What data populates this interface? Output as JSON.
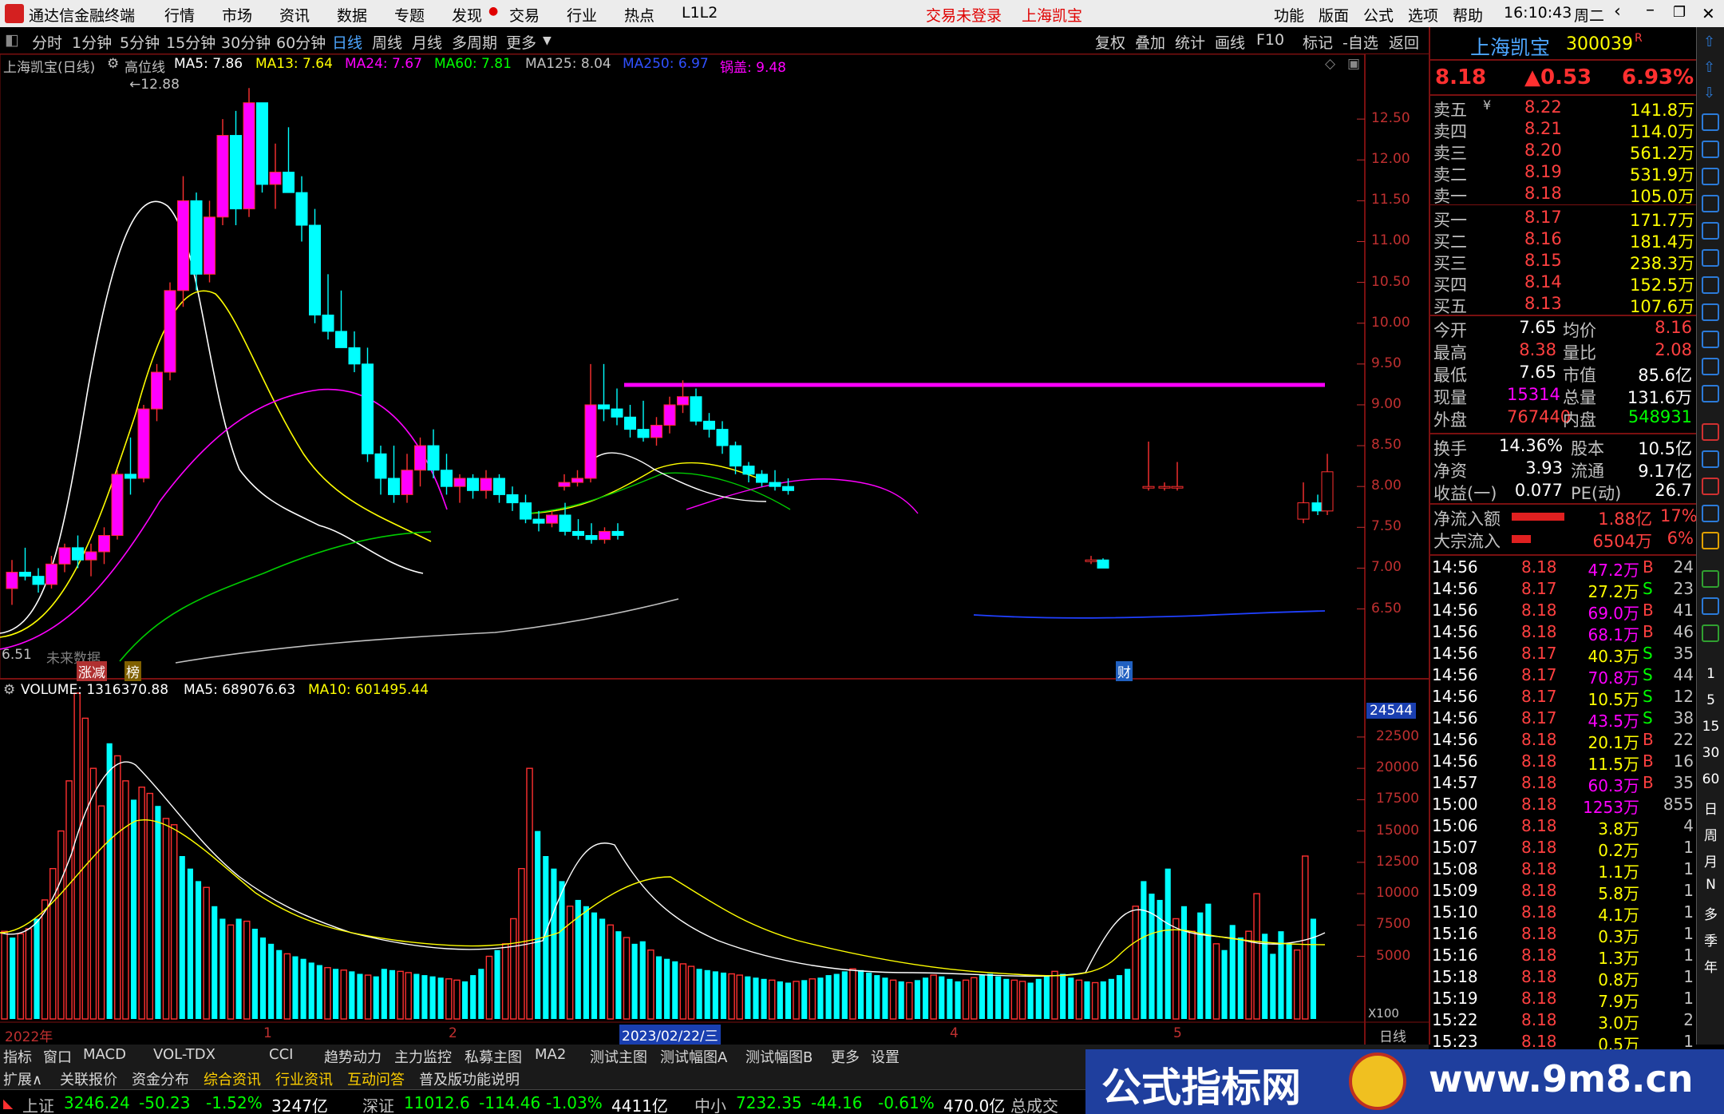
{
  "titlebar": {
    "app_name": "通达信金融终端",
    "menu": [
      "行情",
      "市场",
      "资讯",
      "数据",
      "专题",
      "发现",
      "交易",
      "行业",
      "热点",
      "L1L2"
    ],
    "login_status": "交易未登录",
    "stock_name": "上海凯宝",
    "right_menu": [
      "功能",
      "版面",
      "公式",
      "选项",
      "帮助"
    ],
    "time": "16:10:43",
    "weekday": "周二"
  },
  "periodbar": {
    "periods": [
      "分时",
      "1分钟",
      "5分钟",
      "15分钟",
      "30分钟",
      "60分钟",
      "日线",
      "周线",
      "月线",
      "多周期",
      "更多"
    ],
    "active": "日线",
    "actions": [
      "复权",
      "叠加",
      "统计",
      "画线",
      "F10",
      "标记",
      "-自选",
      "返回"
    ]
  },
  "chart": {
    "header_name": "上海凯宝(日线)",
    "header_indicator": "高位线",
    "ma": [
      {
        "label": "MA5: 7.86",
        "color": "#ffffff"
      },
      {
        "label": "MA13: 7.64",
        "color": "#ffff00"
      },
      {
        "label": "MA24: 7.67",
        "color": "#ff00ff"
      },
      {
        "label": "MA60: 7.81",
        "color": "#00ff00"
      },
      {
        "label": "MA125: 8.04",
        "color": "#c0c0c0"
      },
      {
        "label": "MA250: 6.97",
        "color": "#0000ff"
      },
      {
        "label": "锅盖: 9.48",
        "color": "#ff00ff"
      }
    ],
    "high_mark": "12.88",
    "low_mark": "6.51",
    "note": "未来数据",
    "price_ticks": [
      "12.50",
      "12.00",
      "11.50",
      "11.00",
      "10.50",
      "10.00",
      "9.50",
      "9.00",
      "8.50",
      "8.00",
      "7.50",
      "7.00",
      "6.50"
    ],
    "markers": [
      "涨减",
      "榜",
      "财"
    ],
    "volume_header": "VOLUME: 1316370.88",
    "vol_ma5": "MA5: 689076.63",
    "vol_ma10": "MA10: 601495.44",
    "vol_highlight": "24544",
    "vol_ticks": [
      "22500",
      "20000",
      "17500",
      "15000",
      "12500",
      "10000",
      "7500",
      "5000"
    ],
    "vol_unit": "X100",
    "date_labels": [
      "2022年",
      "1",
      "2",
      "2023/02/22/三",
      "4",
      "5"
    ],
    "period_label": "日线"
  },
  "chart_data": {
    "type": "candlestick",
    "title": "上海凯宝(日线)",
    "ylim": [
      6.3,
      13.0
    ],
    "lid_level": 9.48,
    "candles": [
      [
        6.75,
        7.1,
        6.55,
        6.95
      ],
      [
        6.95,
        7.25,
        6.85,
        6.9
      ],
      [
        6.9,
        7.0,
        6.7,
        6.8
      ],
      [
        6.8,
        7.15,
        6.75,
        7.05
      ],
      [
        7.05,
        7.3,
        6.95,
        7.25
      ],
      [
        7.25,
        7.4,
        7.0,
        7.1
      ],
      [
        7.1,
        7.3,
        6.9,
        7.2
      ],
      [
        7.2,
        7.5,
        7.05,
        7.4
      ],
      [
        7.4,
        8.2,
        7.35,
        8.15
      ],
      [
        8.15,
        8.6,
        7.9,
        8.1
      ],
      [
        8.1,
        9.0,
        8.05,
        8.95
      ],
      [
        8.95,
        9.5,
        8.8,
        9.4
      ],
      [
        9.4,
        10.5,
        9.3,
        10.4
      ],
      [
        10.4,
        11.8,
        10.2,
        11.5
      ],
      [
        11.5,
        11.6,
        10.4,
        10.6
      ],
      [
        10.6,
        11.5,
        10.5,
        11.3
      ],
      [
        11.3,
        12.5,
        11.2,
        12.3
      ],
      [
        12.3,
        12.6,
        11.2,
        11.4
      ],
      [
        11.4,
        12.88,
        11.3,
        12.7
      ],
      [
        12.7,
        12.6,
        11.6,
        11.7
      ],
      [
        11.7,
        12.2,
        11.4,
        11.85
      ],
      [
        11.85,
        12.4,
        11.6,
        11.6
      ],
      [
        11.6,
        11.8,
        11.0,
        11.2
      ],
      [
        11.2,
        11.4,
        10.0,
        10.1
      ],
      [
        10.1,
        10.6,
        9.8,
        9.9
      ],
      [
        9.9,
        10.4,
        9.8,
        9.7
      ],
      [
        9.7,
        9.9,
        9.4,
        9.5
      ],
      [
        9.5,
        9.7,
        8.3,
        8.4
      ],
      [
        8.4,
        8.5,
        7.9,
        8.1
      ],
      [
        8.1,
        8.5,
        7.8,
        7.9
      ],
      [
        7.9,
        8.4,
        7.8,
        8.2
      ],
      [
        8.2,
        8.6,
        8.0,
        8.5
      ],
      [
        8.5,
        8.7,
        8.1,
        8.2
      ],
      [
        8.2,
        8.4,
        7.9,
        8.0
      ],
      [
        8.0,
        8.15,
        7.8,
        8.1
      ],
      [
        8.1,
        8.15,
        7.85,
        7.95
      ],
      [
        7.95,
        8.2,
        7.85,
        8.1
      ],
      [
        8.1,
        8.15,
        7.8,
        7.9
      ],
      [
        7.9,
        8.0,
        7.7,
        7.8
      ],
      [
        7.8,
        7.9,
        7.55,
        7.6
      ],
      [
        7.6,
        7.7,
        7.45,
        7.55
      ],
      [
        7.55,
        7.7,
        7.5,
        7.65
      ],
      [
        7.65,
        7.8,
        7.4,
        7.45
      ],
      [
        7.45,
        7.6,
        7.35,
        7.4
      ],
      [
        7.4,
        7.55,
        7.3,
        7.35
      ],
      [
        7.35,
        7.5,
        7.3,
        7.45
      ],
      [
        7.45,
        7.55,
        7.35,
        7.4
      ]
    ],
    "volume_ticks": [
      5000,
      7500,
      10000,
      12500,
      15000,
      17500,
      20000,
      22500
    ],
    "volume_range": [
      0,
      26000
    ]
  },
  "quote": {
    "name": "上海凯宝",
    "code": "300039",
    "badge": "R",
    "price": "8.18",
    "change": "▲0.53",
    "pct": "6.93%",
    "asks": [
      {
        "label": "卖五",
        "mark": "¥",
        "price": "8.22",
        "vol": "141.8万"
      },
      {
        "label": "卖四",
        "mark": "",
        "price": "8.21",
        "vol": "114.0万"
      },
      {
        "label": "卖三",
        "mark": "",
        "price": "8.20",
        "vol": "561.2万"
      },
      {
        "label": "卖二",
        "mark": "",
        "price": "8.19",
        "vol": "531.9万"
      },
      {
        "label": "卖一",
        "mark": "",
        "price": "8.18",
        "vol": "105.0万"
      }
    ],
    "bids": [
      {
        "label": "买一",
        "price": "8.17",
        "vol": "171.7万"
      },
      {
        "label": "买二",
        "price": "8.16",
        "vol": "181.4万"
      },
      {
        "label": "买三",
        "price": "8.15",
        "vol": "238.3万"
      },
      {
        "label": "买四",
        "price": "8.14",
        "vol": "152.5万"
      },
      {
        "label": "买五",
        "price": "8.13",
        "vol": "107.6万"
      }
    ],
    "stats": [
      {
        "k1": "今开",
        "v1": "7.65",
        "c1": "#ffffff",
        "k2": "均价",
        "v2": "8.16",
        "c2": "#ff4040"
      },
      {
        "k1": "最高",
        "v1": "8.38",
        "c1": "#ff4040",
        "k2": "量比",
        "v2": "2.08",
        "c2": "#ff4040"
      },
      {
        "k1": "最低",
        "v1": "7.65",
        "c1": "#ffffff",
        "k2": "市值",
        "v2": "85.6亿",
        "c2": "#ffffff"
      },
      {
        "k1": "现量",
        "v1": "15314",
        "c1": "#ff00ff",
        "k2": "总量",
        "v2": "131.6万",
        "c2": "#ffffff"
      },
      {
        "k1": "外盘",
        "v1": "767440",
        "c1": "#ff4040",
        "k2": "内盘",
        "v2": "548931",
        "c2": "#00ff00"
      }
    ],
    "fund": [
      {
        "k1": "换手",
        "v1": "14.36%",
        "k2": "股本",
        "v2": "10.5亿"
      },
      {
        "k1": "净资",
        "v1": "3.93",
        "k2": "流通",
        "v2": "9.17亿"
      },
      {
        "k1": "收益(一)",
        "v1": "0.077",
        "k2": "PE(动)",
        "v2": "26.7"
      }
    ],
    "flows": [
      {
        "k": "净流入额",
        "v": "1.88亿",
        "p": "17%",
        "bar": 0.55
      },
      {
        "k": "大宗流入",
        "v": "6504万",
        "p": "6%",
        "bar": 0.2
      }
    ],
    "ticks": [
      {
        "t": "14:56",
        "p": "8.18",
        "v": "47.2万",
        "d": "B",
        "n": "24",
        "pc": "#ff4040",
        "vc": "#ff00ff",
        "dc": "#ff4040"
      },
      {
        "t": "14:56",
        "p": "8.17",
        "v": "27.2万",
        "d": "S",
        "n": "23",
        "pc": "#ff4040",
        "vc": "#ffff00",
        "dc": "#00ff00"
      },
      {
        "t": "14:56",
        "p": "8.18",
        "v": "69.0万",
        "d": "B",
        "n": "41",
        "pc": "#ff4040",
        "vc": "#ff00ff",
        "dc": "#ff4040"
      },
      {
        "t": "14:56",
        "p": "8.18",
        "v": "68.1万",
        "d": "B",
        "n": "46",
        "pc": "#ff4040",
        "vc": "#ff00ff",
        "dc": "#ff4040"
      },
      {
        "t": "14:56",
        "p": "8.17",
        "v": "40.3万",
        "d": "S",
        "n": "35",
        "pc": "#ff4040",
        "vc": "#ffff00",
        "dc": "#00ff00"
      },
      {
        "t": "14:56",
        "p": "8.17",
        "v": "70.8万",
        "d": "S",
        "n": "44",
        "pc": "#ff4040",
        "vc": "#ff00ff",
        "dc": "#00ff00"
      },
      {
        "t": "14:56",
        "p": "8.17",
        "v": "10.5万",
        "d": "S",
        "n": "12",
        "pc": "#ff4040",
        "vc": "#ffff00",
        "dc": "#00ff00"
      },
      {
        "t": "14:56",
        "p": "8.17",
        "v": "43.5万",
        "d": "S",
        "n": "38",
        "pc": "#ff4040",
        "vc": "#ff00ff",
        "dc": "#00ff00"
      },
      {
        "t": "14:56",
        "p": "8.18",
        "v": "20.1万",
        "d": "B",
        "n": "22",
        "pc": "#ff4040",
        "vc": "#ffff00",
        "dc": "#ff4040"
      },
      {
        "t": "14:56",
        "p": "8.18",
        "v": "11.5万",
        "d": "B",
        "n": "16",
        "pc": "#ff4040",
        "vc": "#ffff00",
        "dc": "#ff4040"
      },
      {
        "t": "14:57",
        "p": "8.18",
        "v": "60.3万",
        "d": "B",
        "n": "35",
        "pc": "#ff4040",
        "vc": "#ff00ff",
        "dc": "#ff4040"
      },
      {
        "t": "15:00",
        "p": "8.18",
        "v": "1253万",
        "d": "",
        "n": "855",
        "pc": "#ff4040",
        "vc": "#ff00ff",
        "dc": "#ff4040"
      },
      {
        "t": "15:06",
        "p": "8.18",
        "v": "3.8万",
        "d": "",
        "n": "4",
        "pc": "#ff4040",
        "vc": "#ffff00",
        "dc": "#ff4040"
      },
      {
        "t": "15:07",
        "p": "8.18",
        "v": "0.2万",
        "d": "",
        "n": "1",
        "pc": "#ff4040",
        "vc": "#ffff00",
        "dc": "#ff4040"
      },
      {
        "t": "15:08",
        "p": "8.18",
        "v": "1.1万",
        "d": "",
        "n": "1",
        "pc": "#ff4040",
        "vc": "#ffff00",
        "dc": "#ff4040"
      },
      {
        "t": "15:09",
        "p": "8.18",
        "v": "5.8万",
        "d": "",
        "n": "1",
        "pc": "#ff4040",
        "vc": "#ffff00",
        "dc": "#ff4040"
      },
      {
        "t": "15:10",
        "p": "8.18",
        "v": "4.1万",
        "d": "",
        "n": "1",
        "pc": "#ff4040",
        "vc": "#ffff00",
        "dc": "#ff4040"
      },
      {
        "t": "15:16",
        "p": "8.18",
        "v": "0.3万",
        "d": "",
        "n": "1",
        "pc": "#ff4040",
        "vc": "#ffff00",
        "dc": "#ff4040"
      },
      {
        "t": "15:16",
        "p": "8.18",
        "v": "1.3万",
        "d": "",
        "n": "1",
        "pc": "#ff4040",
        "vc": "#ffff00",
        "dc": "#ff4040"
      },
      {
        "t": "15:18",
        "p": "8.18",
        "v": "0.8万",
        "d": "",
        "n": "1",
        "pc": "#ff4040",
        "vc": "#ffff00",
        "dc": "#ff4040"
      },
      {
        "t": "15:19",
        "p": "8.18",
        "v": "7.9万",
        "d": "",
        "n": "1",
        "pc": "#ff4040",
        "vc": "#ffff00",
        "dc": "#ff4040"
      },
      {
        "t": "15:22",
        "p": "8.18",
        "v": "3.0万",
        "d": "",
        "n": "2",
        "pc": "#ff4040",
        "vc": "#ffff00",
        "dc": "#ff4040"
      },
      {
        "t": "15:23",
        "p": "8.18",
        "v": "0.5万",
        "d": "",
        "n": "1",
        "pc": "#ff4040",
        "vc": "#ffff00",
        "dc": "#ff4040"
      }
    ]
  },
  "strip_text": [
    "1",
    "5",
    "15",
    "30",
    "60",
    "日",
    "周",
    "月",
    "N",
    "多",
    "季",
    "年"
  ],
  "tabs1": [
    "指标",
    "窗口",
    "MACD",
    "VOL-TDX",
    "CCI",
    "趋势动力",
    "主力监控",
    "私募主图",
    "MA2",
    "测试主图",
    "测试幅图A",
    "测试幅图B",
    "更多",
    "设置"
  ],
  "tabs2": [
    "扩展∧",
    "关联报价",
    "资金分布",
    "综合资讯",
    "行业资讯",
    "互动问答",
    "普及版功能说明"
  ],
  "status": [
    {
      "name": "上证",
      "val": "3246.24",
      "chg": "-50.23",
      "pct": "-1.52%",
      "amt": "3247亿"
    },
    {
      "name": "深证",
      "val": "11012.6",
      "chg": "-114.46",
      "pct": "-1.03%",
      "amt": "4411亿"
    },
    {
      "name": "中小",
      "val": "7232.35",
      "chg": "-44.16",
      "pct": "-0.61%",
      "amt": "470.0亿"
    }
  ],
  "status_tail": "总成交",
  "watermark": {
    "text": "公式指标网",
    "url": "www.9m8.cn"
  }
}
